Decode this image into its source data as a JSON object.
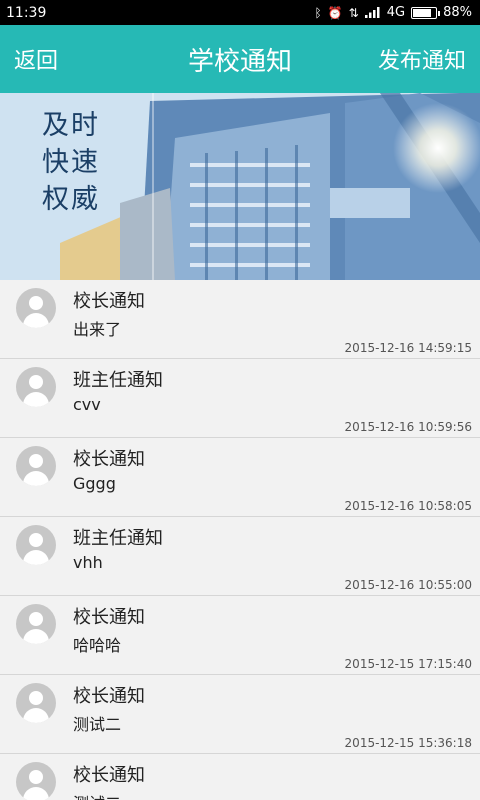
{
  "status_bar": {
    "time": "11:39",
    "network": "4G",
    "battery": "88%",
    "battery_level": 0.88,
    "icons": [
      "bluetooth-icon",
      "alarm-icon",
      "data-transfer-icon",
      "signal-icon",
      "battery-icon"
    ]
  },
  "header": {
    "back_label": "返回",
    "title": "学校通知",
    "publish_label": "发布通知",
    "background_color": "#26b9b5"
  },
  "banner": {
    "slogan": [
      "及时",
      "快速",
      "权威"
    ]
  },
  "notifications": [
    {
      "sender": "校长通知",
      "content": "出来了",
      "time": "2015-12-16 14:59:15"
    },
    {
      "sender": "班主任通知",
      "content": "cvv",
      "time": "2015-12-16 10:59:56"
    },
    {
      "sender": "校长通知",
      "content": "Gggg",
      "time": "2015-12-16 10:58:05"
    },
    {
      "sender": "班主任通知",
      "content": "vhh",
      "time": "2015-12-16 10:55:00"
    },
    {
      "sender": "校长通知",
      "content": "哈哈哈",
      "time": "2015-12-15 17:15:40"
    },
    {
      "sender": "校长通知",
      "content": "测试二",
      "time": "2015-12-15 15:36:18"
    },
    {
      "sender": "校长通知",
      "content": "测试二",
      "time": ""
    }
  ]
}
